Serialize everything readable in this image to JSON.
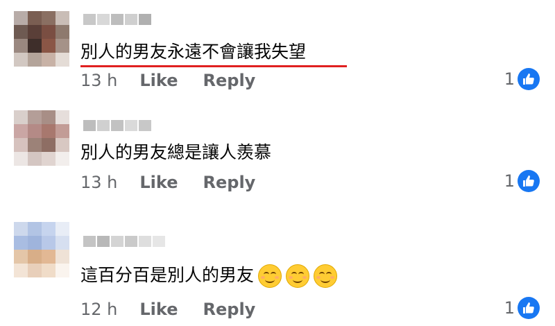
{
  "comments": [
    {
      "text": "別人的男友永遠不會讓我失望",
      "time": "13 h",
      "like_label": "Like",
      "reply_label": "Reply",
      "reaction_count": "1",
      "reaction_icon": "thumbs-up-icon",
      "emojis": [],
      "highlight_color": "#e02020"
    },
    {
      "text": "別人的男友總是讓人羨慕",
      "time": "13 h",
      "like_label": "Like",
      "reply_label": "Reply",
      "reaction_count": "1",
      "reaction_icon": "thumbs-up-icon",
      "emojis": []
    },
    {
      "text": "這百分百是別人的男友",
      "time": "12 h",
      "like_label": "Like",
      "reply_label": "Reply",
      "reaction_count": "1",
      "reaction_icon": "thumbs-up-icon",
      "emojis": [
        "smiling-face-icon",
        "smiling-face-icon",
        "smiling-face-icon"
      ]
    }
  ],
  "colors": {
    "accent": "#1877f2",
    "meta_text": "#65676b",
    "body_text": "#050505"
  }
}
